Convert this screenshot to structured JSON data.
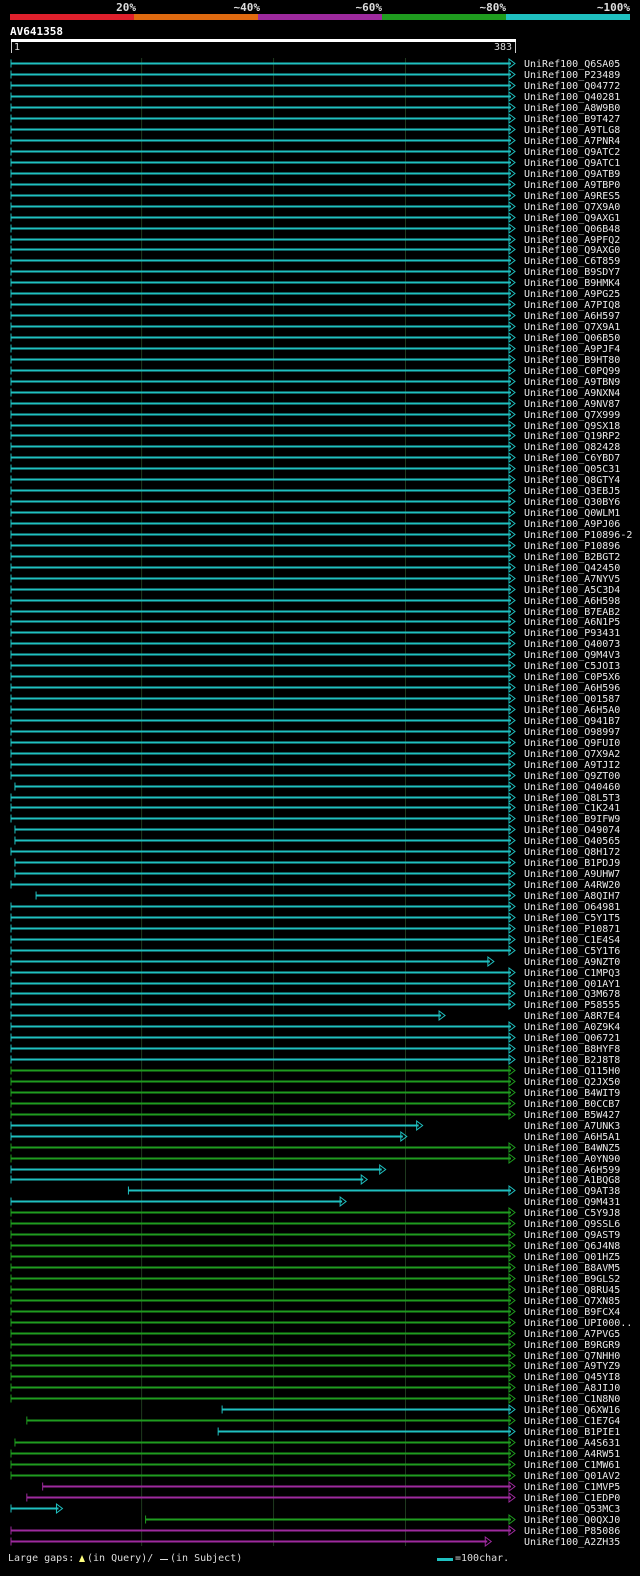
{
  "chart_data": {
    "type": "alignment-overview",
    "query": {
      "id": "AV641358",
      "start": "1",
      "end": "383"
    },
    "identity_legend": [
      {
        "label": "20%",
        "color": "#e0202c"
      },
      {
        "label": "~40%",
        "color": "#e06a10"
      },
      {
        "label": "~60%",
        "color": "#9e2a9e"
      },
      {
        "label": "~80%",
        "color": "#1f9c1f"
      },
      {
        "label": "~100%",
        "color": "#1fc0c0"
      }
    ],
    "footer": {
      "large_gaps_label": "Large gaps:",
      "query_gap_label": "(in Query)/",
      "subject_gap_label": "(in Subject)",
      "scale_label": "=100char."
    },
    "hits": [
      {
        "id": "UniRef100_Q6SA05",
        "start": 1,
        "end": 383,
        "cls": "c"
      },
      {
        "id": "UniRef100_P23489",
        "start": 1,
        "end": 383,
        "cls": "c"
      },
      {
        "id": "UniRef100_Q04772",
        "start": 1,
        "end": 383,
        "cls": "c"
      },
      {
        "id": "UniRef100_Q40281",
        "start": 1,
        "end": 383,
        "cls": "c"
      },
      {
        "id": "UniRef100_A8W9B0",
        "start": 1,
        "end": 383,
        "cls": "c"
      },
      {
        "id": "UniRef100_B9T427",
        "start": 1,
        "end": 383,
        "cls": "c"
      },
      {
        "id": "UniRef100_A9TLG8",
        "start": 1,
        "end": 383,
        "cls": "c"
      },
      {
        "id": "UniRef100_A7PNR4",
        "start": 1,
        "end": 383,
        "cls": "c"
      },
      {
        "id": "UniRef100_Q9ATC2",
        "start": 1,
        "end": 383,
        "cls": "c"
      },
      {
        "id": "UniRef100_Q9ATC1",
        "start": 1,
        "end": 383,
        "cls": "c"
      },
      {
        "id": "UniRef100_Q9ATB9",
        "start": 1,
        "end": 383,
        "cls": "c"
      },
      {
        "id": "UniRef100_A9TBP0",
        "start": 1,
        "end": 383,
        "cls": "c"
      },
      {
        "id": "UniRef100_A9RES5",
        "start": 1,
        "end": 383,
        "cls": "c"
      },
      {
        "id": "UniRef100_Q7X9A0",
        "start": 1,
        "end": 383,
        "cls": "c"
      },
      {
        "id": "UniRef100_Q9AXG1",
        "start": 1,
        "end": 383,
        "cls": "c"
      },
      {
        "id": "UniRef100_Q06B48",
        "start": 1,
        "end": 383,
        "cls": "c"
      },
      {
        "id": "UniRef100_A9PFQ2",
        "start": 1,
        "end": 383,
        "cls": "c"
      },
      {
        "id": "UniRef100_Q9AXG0",
        "start": 1,
        "end": 383,
        "cls": "c"
      },
      {
        "id": "UniRef100_C6T859",
        "start": 1,
        "end": 383,
        "cls": "c"
      },
      {
        "id": "UniRef100_B9SDY7",
        "start": 1,
        "end": 383,
        "cls": "c"
      },
      {
        "id": "UniRef100_B9HMK4",
        "start": 1,
        "end": 383,
        "cls": "c"
      },
      {
        "id": "UniRef100_A9PG25",
        "start": 1,
        "end": 383,
        "cls": "c"
      },
      {
        "id": "UniRef100_A7PIQ8",
        "start": 1,
        "end": 383,
        "cls": "c"
      },
      {
        "id": "UniRef100_A6H597",
        "start": 1,
        "end": 383,
        "cls": "c"
      },
      {
        "id": "UniRef100_Q7X9A1",
        "start": 1,
        "end": 383,
        "cls": "c"
      },
      {
        "id": "UniRef100_Q06B50",
        "start": 1,
        "end": 383,
        "cls": "c"
      },
      {
        "id": "UniRef100_A9PJF4",
        "start": 1,
        "end": 383,
        "cls": "c"
      },
      {
        "id": "UniRef100_B9HT80",
        "start": 1,
        "end": 383,
        "cls": "c"
      },
      {
        "id": "UniRef100_C0PQ99",
        "start": 1,
        "end": 383,
        "cls": "c"
      },
      {
        "id": "UniRef100_A9TBN9",
        "start": 1,
        "end": 383,
        "cls": "c"
      },
      {
        "id": "UniRef100_A9NXN4",
        "start": 1,
        "end": 383,
        "cls": "c"
      },
      {
        "id": "UniRef100_A9NV87",
        "start": 1,
        "end": 383,
        "cls": "c"
      },
      {
        "id": "UniRef100_Q7X999",
        "start": 1,
        "end": 383,
        "cls": "c"
      },
      {
        "id": "UniRef100_Q9SX18",
        "start": 1,
        "end": 383,
        "cls": "c"
      },
      {
        "id": "UniRef100_Q19RP2",
        "start": 1,
        "end": 383,
        "cls": "c"
      },
      {
        "id": "UniRef100_Q82428",
        "start": 1,
        "end": 383,
        "cls": "c"
      },
      {
        "id": "UniRef100_C6YBD7",
        "start": 1,
        "end": 383,
        "cls": "c"
      },
      {
        "id": "UniRef100_Q05C31",
        "start": 1,
        "end": 383,
        "cls": "c"
      },
      {
        "id": "UniRef100_Q8GTY4",
        "start": 1,
        "end": 383,
        "cls": "c"
      },
      {
        "id": "UniRef100_Q3EBJ5",
        "start": 1,
        "end": 383,
        "cls": "c"
      },
      {
        "id": "UniRef100_Q30BY6",
        "start": 1,
        "end": 383,
        "cls": "c"
      },
      {
        "id": "UniRef100_Q0WLM1",
        "start": 1,
        "end": 383,
        "cls": "c"
      },
      {
        "id": "UniRef100_A9PJ06",
        "start": 1,
        "end": 383,
        "cls": "c"
      },
      {
        "id": "UniRef100_P10896-2",
        "start": 1,
        "end": 383,
        "cls": "c"
      },
      {
        "id": "UniRef100_P10896",
        "start": 1,
        "end": 383,
        "cls": "c"
      },
      {
        "id": "UniRef100_B2BGT2",
        "start": 1,
        "end": 383,
        "cls": "c"
      },
      {
        "id": "UniRef100_Q42450",
        "start": 1,
        "end": 383,
        "cls": "c"
      },
      {
        "id": "UniRef100_A7NYV5",
        "start": 1,
        "end": 383,
        "cls": "c"
      },
      {
        "id": "UniRef100_A5C3D4",
        "start": 1,
        "end": 383,
        "cls": "c"
      },
      {
        "id": "UniRef100_A6H598",
        "start": 1,
        "end": 383,
        "cls": "c"
      },
      {
        "id": "UniRef100_B7EAB2",
        "start": 1,
        "end": 383,
        "cls": "c"
      },
      {
        "id": "UniRef100_A6N1P5",
        "start": 1,
        "end": 383,
        "cls": "c"
      },
      {
        "id": "UniRef100_P93431",
        "start": 1,
        "end": 383,
        "cls": "c"
      },
      {
        "id": "UniRef100_Q40073",
        "start": 1,
        "end": 383,
        "cls": "c"
      },
      {
        "id": "UniRef100_Q9M4V3",
        "start": 1,
        "end": 383,
        "cls": "c"
      },
      {
        "id": "UniRef100_C5JOI3",
        "start": 1,
        "end": 383,
        "cls": "c"
      },
      {
        "id": "UniRef100_C0P5X6",
        "start": 1,
        "end": 383,
        "cls": "c"
      },
      {
        "id": "UniRef100_A6H596",
        "start": 1,
        "end": 383,
        "cls": "c"
      },
      {
        "id": "UniRef100_Q01587",
        "start": 1,
        "end": 383,
        "cls": "c"
      },
      {
        "id": "UniRef100_A6H5A0",
        "start": 1,
        "end": 383,
        "cls": "c"
      },
      {
        "id": "UniRef100_Q941B7",
        "start": 1,
        "end": 383,
        "cls": "c"
      },
      {
        "id": "UniRef100_O98997",
        "start": 1,
        "end": 383,
        "cls": "c"
      },
      {
        "id": "UniRef100_Q9FUI0",
        "start": 1,
        "end": 383,
        "cls": "c"
      },
      {
        "id": "UniRef100_Q7X9A2",
        "start": 1,
        "end": 383,
        "cls": "c"
      },
      {
        "id": "UniRef100_A9TJI2",
        "start": 1,
        "end": 383,
        "cls": "c"
      },
      {
        "id": "UniRef100_Q9ZT00",
        "start": 1,
        "end": 383,
        "cls": "c"
      },
      {
        "id": "UniRef100_Q40460",
        "start": 4,
        "end": 383,
        "cls": "c"
      },
      {
        "id": "UniRef100_Q8L5T3",
        "start": 1,
        "end": 383,
        "cls": "c"
      },
      {
        "id": "UniRef100_C1K241",
        "start": 1,
        "end": 383,
        "cls": "c"
      },
      {
        "id": "UniRef100_B9IFW9",
        "start": 1,
        "end": 383,
        "cls": "c"
      },
      {
        "id": "UniRef100_O49074",
        "start": 4,
        "end": 383,
        "cls": "c"
      },
      {
        "id": "UniRef100_Q40565",
        "start": 4,
        "end": 383,
        "cls": "c"
      },
      {
        "id": "UniRef100_Q8H172",
        "start": 1,
        "end": 383,
        "cls": "c"
      },
      {
        "id": "UniRef100_B1PDJ9",
        "start": 4,
        "end": 383,
        "cls": "c"
      },
      {
        "id": "UniRef100_A9UHW7",
        "start": 4,
        "end": 383,
        "cls": "c"
      },
      {
        "id": "UniRef100_A4RW20",
        "start": 1,
        "end": 383,
        "cls": "c"
      },
      {
        "id": "UniRef100_A8QIH7",
        "start": 20,
        "end": 383,
        "cls": "c"
      },
      {
        "id": "UniRef100_O64981",
        "start": 1,
        "end": 383,
        "cls": "c"
      },
      {
        "id": "UniRef100_C5Y1T5",
        "start": 1,
        "end": 383,
        "cls": "c"
      },
      {
        "id": "UniRef100_P10871",
        "start": 1,
        "end": 383,
        "cls": "c"
      },
      {
        "id": "UniRef100_C1E4S4",
        "start": 1,
        "end": 383,
        "cls": "c"
      },
      {
        "id": "UniRef100_C5Y1T6",
        "start": 1,
        "end": 383,
        "cls": "c"
      },
      {
        "id": "UniRef100_A9NZT0",
        "start": 1,
        "end": 367,
        "cls": "c"
      },
      {
        "id": "UniRef100_C1MPQ3",
        "start": 1,
        "end": 383,
        "cls": "c"
      },
      {
        "id": "UniRef100_Q01AY1",
        "start": 1,
        "end": 383,
        "cls": "c"
      },
      {
        "id": "UniRef100_Q3M678",
        "start": 1,
        "end": 383,
        "cls": "c"
      },
      {
        "id": "UniRef100_P58555",
        "start": 1,
        "end": 383,
        "cls": "c"
      },
      {
        "id": "UniRef100_A8R7E4",
        "start": 1,
        "end": 330,
        "cls": "c"
      },
      {
        "id": "UniRef100_A0Z9K4",
        "start": 1,
        "end": 383,
        "cls": "c"
      },
      {
        "id": "UniRef100_Q06721",
        "start": 1,
        "end": 383,
        "cls": "c"
      },
      {
        "id": "UniRef100_B8HYF8",
        "start": 1,
        "end": 383,
        "cls": "c"
      },
      {
        "id": "UniRef100_B2J8T8",
        "start": 1,
        "end": 383,
        "cls": "c"
      },
      {
        "id": "UniRef100_Q115H0",
        "start": 1,
        "end": 383,
        "cls": "g"
      },
      {
        "id": "UniRef100_Q2JX50",
        "start": 1,
        "end": 383,
        "cls": "g"
      },
      {
        "id": "UniRef100_B4WIT9",
        "start": 1,
        "end": 383,
        "cls": "g"
      },
      {
        "id": "UniRef100_B0CCB7",
        "start": 1,
        "end": 383,
        "cls": "g"
      },
      {
        "id": "UniRef100_B5W427",
        "start": 1,
        "end": 383,
        "cls": "g"
      },
      {
        "id": "UniRef100_A7UNK3",
        "start": 1,
        "end": 313,
        "cls": "c"
      },
      {
        "id": "UniRef100_A6H5A1",
        "start": 1,
        "end": 301,
        "cls": "c"
      },
      {
        "id": "UniRef100_B4WNZ5",
        "start": 1,
        "end": 383,
        "cls": "g"
      },
      {
        "id": "UniRef100_A0YN90",
        "start": 1,
        "end": 383,
        "cls": "g"
      },
      {
        "id": "UniRef100_A6H599",
        "start": 1,
        "end": 285,
        "cls": "c"
      },
      {
        "id": "UniRef100_A1BQG8",
        "start": 1,
        "end": 271,
        "cls": "c"
      },
      {
        "id": "UniRef100_Q9AT38",
        "start": 90,
        "end": 383,
        "cls": "c"
      },
      {
        "id": "UniRef100_Q9M431",
        "start": 1,
        "end": 255,
        "cls": "c"
      },
      {
        "id": "UniRef100_C5Y9J8",
        "start": 1,
        "end": 383,
        "cls": "g"
      },
      {
        "id": "UniRef100_Q9SSL6",
        "start": 1,
        "end": 383,
        "cls": "g"
      },
      {
        "id": "UniRef100_Q9AST9",
        "start": 1,
        "end": 383,
        "cls": "g"
      },
      {
        "id": "UniRef100_Q6J4N8",
        "start": 1,
        "end": 383,
        "cls": "g"
      },
      {
        "id": "UniRef100_Q01HZ5",
        "start": 1,
        "end": 383,
        "cls": "g"
      },
      {
        "id": "UniRef100_B8AVM5",
        "start": 1,
        "end": 383,
        "cls": "g"
      },
      {
        "id": "UniRef100_B9GLS2",
        "start": 1,
        "end": 383,
        "cls": "g"
      },
      {
        "id": "UniRef100_Q8RU45",
        "start": 1,
        "end": 383,
        "cls": "g"
      },
      {
        "id": "UniRef100_Q7XN85",
        "start": 1,
        "end": 383,
        "cls": "g"
      },
      {
        "id": "UniRef100_B9FCX4",
        "start": 1,
        "end": 383,
        "cls": "g"
      },
      {
        "id": "UniRef100_UPI000..",
        "start": 1,
        "end": 383,
        "cls": "g"
      },
      {
        "id": "UniRef100_A7PVG5",
        "start": 1,
        "end": 383,
        "cls": "g"
      },
      {
        "id": "UniRef100_B9RGR9",
        "start": 1,
        "end": 383,
        "cls": "g"
      },
      {
        "id": "UniRef100_Q7NHH0",
        "start": 1,
        "end": 383,
        "cls": "g"
      },
      {
        "id": "UniRef100_A9TYZ9",
        "start": 1,
        "end": 383,
        "cls": "g"
      },
      {
        "id": "UniRef100_Q45YI8",
        "start": 1,
        "end": 383,
        "cls": "g"
      },
      {
        "id": "UniRef100_A8JIJ0",
        "start": 1,
        "end": 383,
        "cls": "g"
      },
      {
        "id": "UniRef100_C1N8N0",
        "start": 1,
        "end": 383,
        "cls": "g"
      },
      {
        "id": "UniRef100_Q6XW16",
        "start": 161,
        "end": 383,
        "cls": "c"
      },
      {
        "id": "UniRef100_C1E7G4",
        "start": 13,
        "end": 383,
        "cls": "g"
      },
      {
        "id": "UniRef100_B1PIE1",
        "start": 158,
        "end": 383,
        "cls": "c"
      },
      {
        "id": "UniRef100_A4S631",
        "start": 4,
        "end": 383,
        "cls": "g"
      },
      {
        "id": "UniRef100_A4RW51",
        "start": 1,
        "end": 383,
        "cls": "g"
      },
      {
        "id": "UniRef100_C1MW61",
        "start": 1,
        "end": 383,
        "cls": "g"
      },
      {
        "id": "UniRef100_Q01AV2",
        "start": 1,
        "end": 383,
        "cls": "g"
      },
      {
        "id": "UniRef100_C1MVP5",
        "start": 25,
        "end": 383,
        "cls": "m"
      },
      {
        "id": "UniRef100_C1EDP0",
        "start": 13,
        "end": 383,
        "cls": "m"
      },
      {
        "id": "UniRef100_Q53MC3",
        "start": 1,
        "end": 40,
        "cls": "c"
      },
      {
        "id": "UniRef100_Q0QXJ0",
        "start": 103,
        "end": 383,
        "cls": "g"
      },
      {
        "id": "UniRef100_P85086",
        "start": 1,
        "end": 383,
        "cls": "m"
      },
      {
        "id": "UniRef100_A2ZH35",
        "start": 1,
        "end": 365,
        "cls": "m"
      }
    ]
  }
}
